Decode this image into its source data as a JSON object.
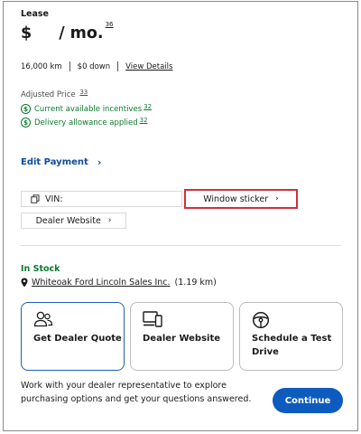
{
  "lease": {
    "label": "Lease",
    "currency": "$",
    "period": "/ mo.",
    "footnote": "36"
  },
  "terms": {
    "mileage": "16,000 km",
    "down": "$0 down",
    "details_link": "View Details"
  },
  "adjusted": {
    "label": "Adjusted Price",
    "footnote": "33",
    "items": [
      {
        "icon": "dollar-circle-icon",
        "text": "Current available incentives",
        "footnote": "32"
      },
      {
        "icon": "dollar-circle-icon",
        "text": "Delivery allowance applied",
        "footnote": "32"
      }
    ]
  },
  "edit_payment": {
    "label": "Edit Payment",
    "chevron": "›"
  },
  "vin": {
    "label": "VIN:",
    "icon": "copy-icon"
  },
  "window_sticker": {
    "label": "Window sticker",
    "chevron": "›"
  },
  "dealer_website_link": {
    "label": "Dealer Website",
    "chevron": "›"
  },
  "stock": {
    "status": "In Stock",
    "dealer_name": "Whiteoak Ford Lincoln Sales Inc.",
    "distance": "(1.19 km)"
  },
  "actions": [
    {
      "icon": "people-icon",
      "label": "Get Dealer Quote",
      "selected": true
    },
    {
      "icon": "devices-icon",
      "label": "Dealer Website",
      "selected": false
    },
    {
      "icon": "steering-wheel-icon",
      "label": "Schedule a Test Drive",
      "selected": false
    }
  ],
  "note": "Work with your dealer representative to explore purchasing options and get your questions answered.",
  "continue_label": "Continue",
  "colors": {
    "green": "#0a7a2e",
    "blue_link": "#0e4ca1",
    "primary_button": "#0e5bbf",
    "highlight_border": "#d0303a"
  }
}
